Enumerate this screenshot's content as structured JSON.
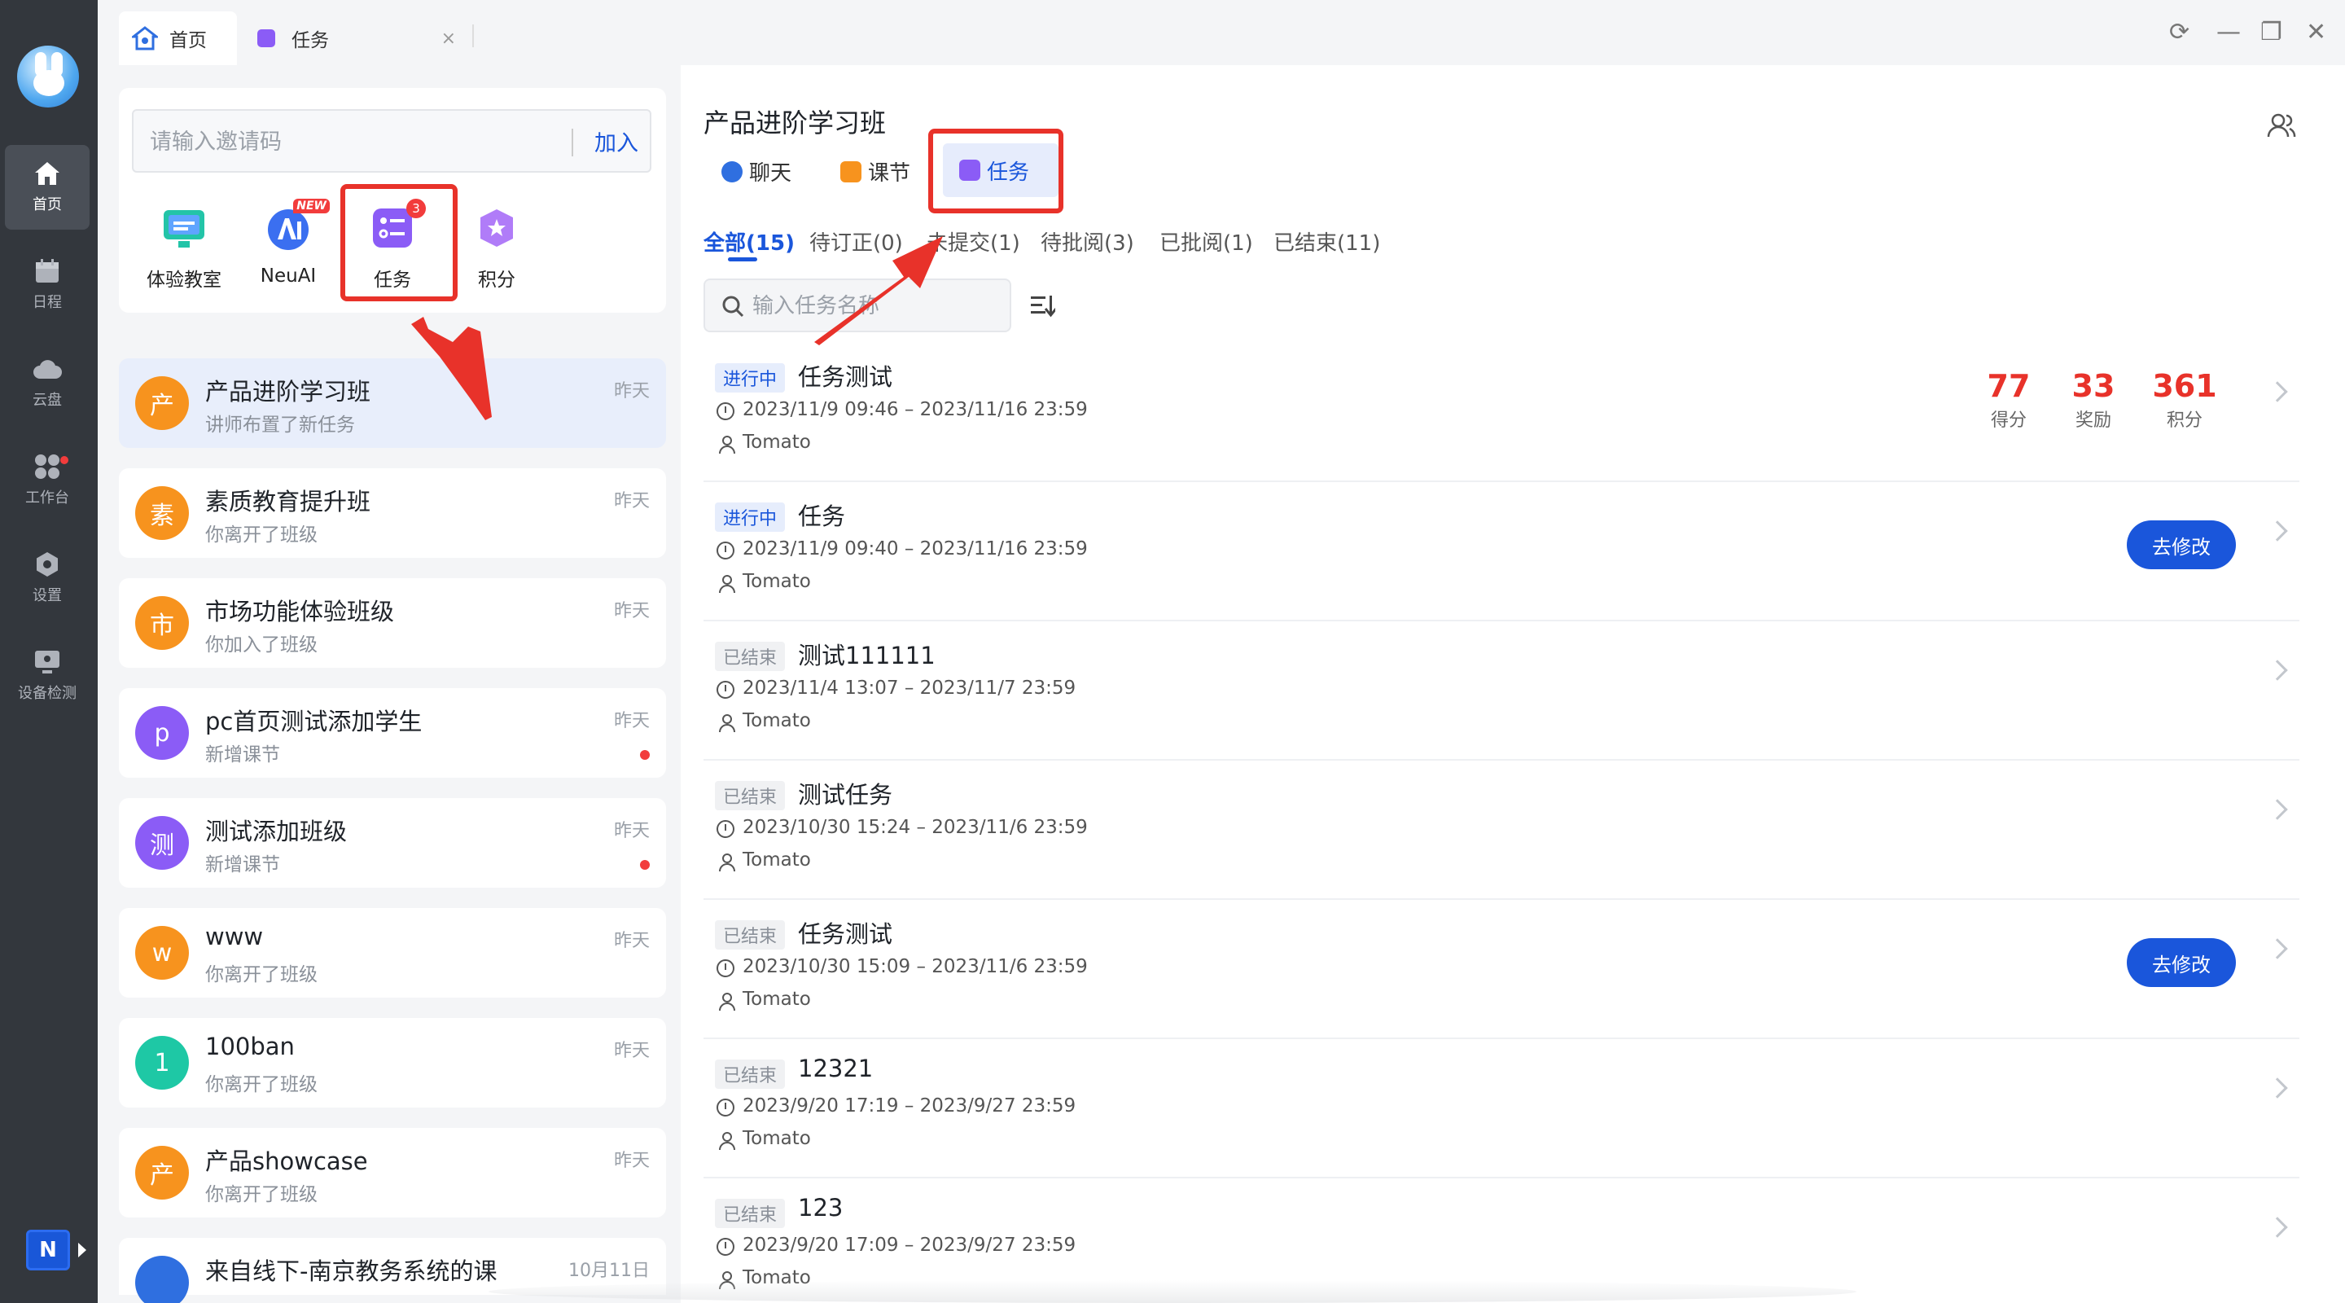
{
  "window": {
    "tabs": [
      {
        "label": "首页"
      },
      {
        "label": "任务",
        "close": "×"
      }
    ],
    "controls": {
      "refresh": "⟳",
      "minimize": "—",
      "restore": "❐",
      "close": "✕"
    }
  },
  "sidebar": {
    "items": [
      {
        "label": "首页",
        "icon": "home-icon"
      },
      {
        "label": "日程",
        "icon": "calendar-icon"
      },
      {
        "label": "云盘",
        "icon": "cloud-icon"
      },
      {
        "label": "工作台",
        "icon": "workbench-icon"
      },
      {
        "label": "设置",
        "icon": "settings-icon"
      },
      {
        "label": "设备检测",
        "icon": "device-check-icon"
      }
    ],
    "logo_letter": "N"
  },
  "invite": {
    "placeholder": "请输入邀请码",
    "join_label": "加入"
  },
  "quick": [
    {
      "label": "体验教室",
      "icon": "classroom-icon"
    },
    {
      "label": "NeuAI",
      "icon": "neuai-icon",
      "badge": "NEW"
    },
    {
      "label": "任务",
      "icon": "task-icon",
      "badge": "3"
    },
    {
      "label": "积分",
      "icon": "points-icon"
    }
  ],
  "classes": [
    {
      "avatar": "产",
      "name": "产品进阶学习班",
      "sub": "讲师布置了新任务",
      "time": "昨天",
      "color": "#f7931e"
    },
    {
      "avatar": "素",
      "name": "素质教育提升班",
      "sub": "你离开了班级",
      "time": "昨天",
      "color": "#f7931e"
    },
    {
      "avatar": "市",
      "name": "市场功能体验班级",
      "sub": "你加入了班级",
      "time": "昨天",
      "color": "#f7931e"
    },
    {
      "avatar": "p",
      "name": "pc首页测试添加学生",
      "sub": "新增课节",
      "time": "昨天",
      "color": "#8b5cf6"
    },
    {
      "avatar": "测",
      "name": "测试添加班级",
      "sub": "新增课节",
      "time": "昨天",
      "color": "#8b5cf6"
    },
    {
      "avatar": "w",
      "name": "www",
      "sub": "你离开了班级",
      "time": "昨天",
      "color": "#f7931e"
    },
    {
      "avatar": "1",
      "name": "100ban",
      "sub": "你离开了班级",
      "time": "昨天",
      "color": "#1ec8a5"
    },
    {
      "avatar": "产",
      "name": "产品showcase",
      "sub": "你离开了班级",
      "time": "昨天",
      "color": "#f7931e"
    },
    {
      "avatar": "",
      "name": "来自线下-南京教务系统的课",
      "sub": "",
      "time": "10月11日",
      "color": "#2f6fe0"
    }
  ],
  "main": {
    "title": "产品进阶学习班",
    "subtabs": [
      {
        "label": "聊天",
        "icon": "chat-icon",
        "color": "#2f6fe0"
      },
      {
        "label": "课节",
        "icon": "lesson-icon",
        "color": "#f7931e"
      },
      {
        "label": "任务",
        "icon": "task-icon",
        "color": "#8b5cf6"
      }
    ],
    "filters": [
      {
        "label": "全部(15)"
      },
      {
        "label": "待订正(0)"
      },
      {
        "label": "未提交(1)"
      },
      {
        "label": "待批阅(3)"
      },
      {
        "label": "已批阅(1)"
      },
      {
        "label": "已结束(11)"
      }
    ],
    "search_placeholder": "输入任务名称",
    "tasks": [
      {
        "status": "进行中",
        "kind": "running",
        "name": "任务测试",
        "time": "2023/11/9 09:46 – 2023/11/16 23:59",
        "author": "Tomato"
      },
      {
        "status": "进行中",
        "kind": "running",
        "name": "任务",
        "time": "2023/11/9 09:40 – 2023/11/16 23:59",
        "author": "Tomato",
        "button": "去修改"
      },
      {
        "status": "已结束",
        "kind": "ended",
        "name": "测试111111",
        "time": "2023/11/4 13:07 – 2023/11/7 23:59",
        "author": "Tomato"
      },
      {
        "status": "已结束",
        "kind": "ended",
        "name": "测试任务",
        "time": "2023/10/30 15:24 – 2023/11/6 23:59",
        "author": "Tomato"
      },
      {
        "status": "已结束",
        "kind": "ended",
        "name": "任务测试",
        "time": "2023/10/30 15:09 – 2023/11/6 23:59",
        "author": "Tomato",
        "button": "去修改"
      },
      {
        "status": "已结束",
        "kind": "ended",
        "name": "12321",
        "time": "2023/9/20 17:19 – 2023/9/27 23:59",
        "author": "Tomato"
      },
      {
        "status": "已结束",
        "kind": "ended",
        "name": "123",
        "time": "2023/9/20 17:09 – 2023/9/27 23:59",
        "author": "Tomato"
      }
    ],
    "stats": [
      {
        "num": "77",
        "label": "得分"
      },
      {
        "num": "33",
        "label": "奖励"
      },
      {
        "num": "361",
        "label": "积分"
      }
    ]
  },
  "accent": "#1a56db",
  "highlight": "#e8322a"
}
